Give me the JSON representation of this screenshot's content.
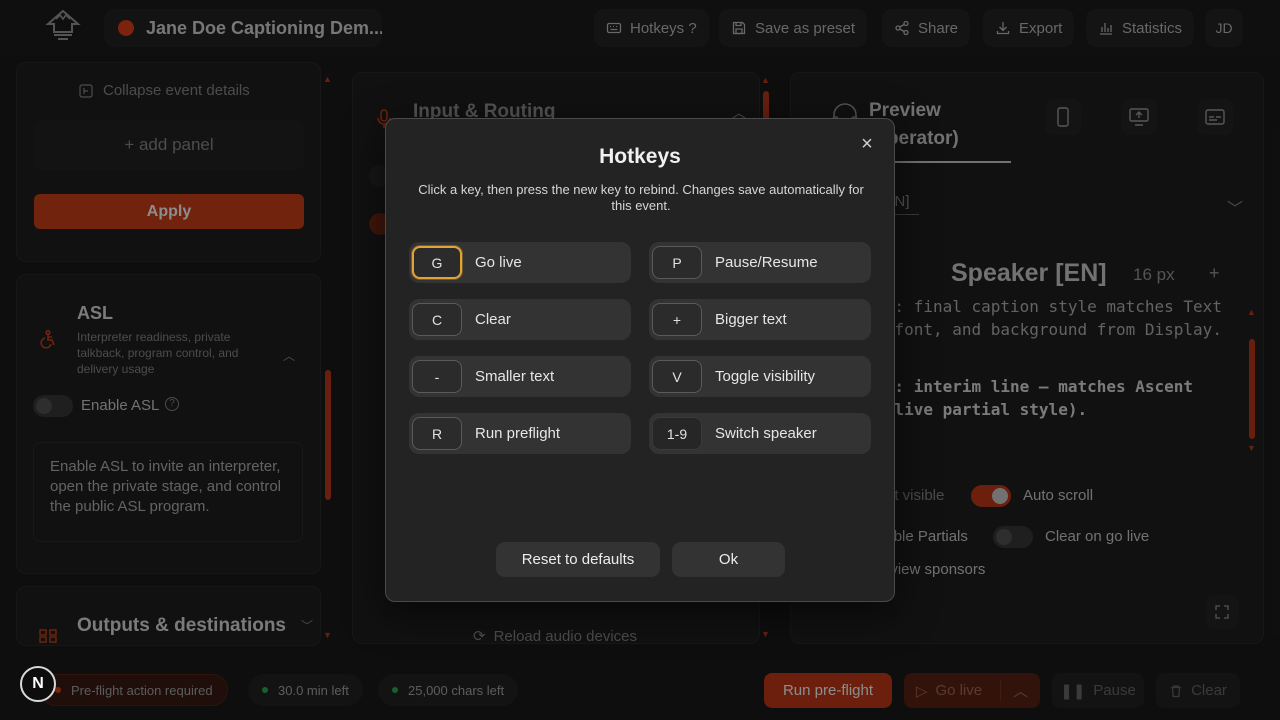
{
  "topbar": {
    "event_title": "Jane Doe Captioning Dem...",
    "buttons": {
      "hotkeys": "Hotkeys ?",
      "save_preset": "Save as preset",
      "share": "Share",
      "export": "Export",
      "statistics": "Statistics"
    },
    "avatar_initials": "JD"
  },
  "left": {
    "collapse_event_details": "Collapse event details",
    "add_panel": "+ add panel",
    "apply": "Apply",
    "asl": {
      "title": "ASL",
      "description": "Interpreter readiness, private talkback, program control, and delivery usage",
      "enable_label": "Enable ASL",
      "info_text": "Enable ASL to invite an interpreter, open the private stage, and control the public ASL program."
    },
    "outputs_title": "Outputs & destinations"
  },
  "middle": {
    "section_title": "Input & Routing",
    "reload_audio": "Reload audio devices"
  },
  "right": {
    "preview_tab": "Preview (operator)",
    "language_select": "English [EN]",
    "speaker_label": "Speaker [EN]",
    "font_size": "16 px",
    "preview_final": "Preview: final caption style matches Text color, font, and background from Display.",
    "preview_interim": "Preview: interim line — matches Ascent color (live partial style).",
    "toggles": {
      "text_visible": "Text visible",
      "auto_scroll": "Auto scroll",
      "enable_partials": "Enable Partials",
      "clear_on_go_live": "Clear on go live",
      "preview_sponsors": "Preview sponsors"
    }
  },
  "bottombar": {
    "badge": "N",
    "preflight_status": "Pre-flight action required",
    "time_left": "30.0 min left",
    "chars_left": "25,000 chars left",
    "run_preflight": "Run pre-flight",
    "go_live": "Go live",
    "pause": "Pause",
    "clear": "Clear"
  },
  "modal": {
    "title": "Hotkeys",
    "description": "Click a key, then press the new key to rebind. Changes save automatically for this event.",
    "hotkeys": [
      {
        "key": "G",
        "action": "Go live"
      },
      {
        "key": "P",
        "action": "Pause/Resume"
      },
      {
        "key": "C",
        "action": "Clear"
      },
      {
        "key": "+",
        "action": "Bigger text"
      },
      {
        "key": "-",
        "action": "Smaller text"
      },
      {
        "key": "V",
        "action": "Toggle visibility"
      },
      {
        "key": "R",
        "action": "Run preflight"
      },
      {
        "key": "1-9",
        "action": "Switch speaker"
      }
    ],
    "reset_label": "Reset to defaults",
    "ok_label": "Ok"
  },
  "colors": {
    "accent": "#d0401b",
    "focus_ring": "#e3a236",
    "status_green": "#2fae57",
    "status_red": "#e2401a"
  }
}
